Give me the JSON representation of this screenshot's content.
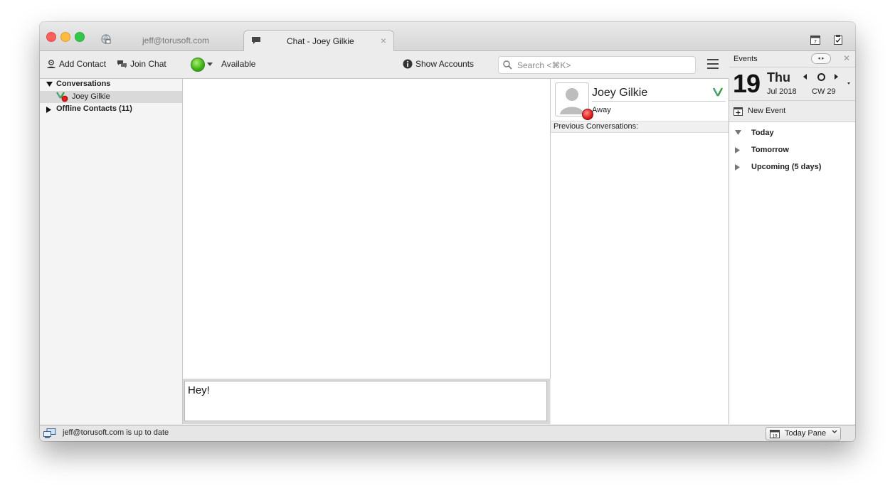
{
  "tabs": [
    {
      "label": "jeff@torusoft.com",
      "icon": "account-globe-icon",
      "active": false
    },
    {
      "label": "Chat - Joey Gilkie",
      "icon": "chat-bubble-icon",
      "active": true,
      "close": "×"
    }
  ],
  "titlebar_icons": [
    "calendar-icon",
    "tasks-icon"
  ],
  "toolbar": {
    "add_contact": "Add Contact",
    "join_chat": "Join Chat",
    "status_label": "Available",
    "show_accounts": "Show Accounts",
    "search_placeholder": "Search <⌘K>"
  },
  "contacts": {
    "groups": [
      {
        "label": "Conversations",
        "expanded": true
      },
      {
        "label": "Offline Contacts (11)",
        "expanded": false
      }
    ],
    "items": [
      {
        "name": "Joey Gilkie",
        "selected": true
      }
    ]
  },
  "chat": {
    "input_value": "Hey!"
  },
  "contact_info": {
    "name": "Joey Gilkie",
    "status": "Away",
    "previous_conversations": "Previous Conversations:"
  },
  "events": {
    "title": "Events",
    "day_number": "19",
    "day_name": "Thu",
    "month_year": "Jul 2018",
    "calendar_week": "CW 29",
    "new_event": "New Event",
    "sections": [
      {
        "label": "Today",
        "expanded": true
      },
      {
        "label": "Tomorrow",
        "expanded": false
      },
      {
        "label": "Upcoming (5 days)",
        "expanded": false
      }
    ]
  },
  "statusbar": {
    "text": "jeff@torusoft.com is up to date",
    "today_pane": "Today Pane"
  },
  "colors": {
    "status_available": "#3fae15",
    "status_away": "#e21b1b",
    "selected_row": "#d9d9d9"
  }
}
